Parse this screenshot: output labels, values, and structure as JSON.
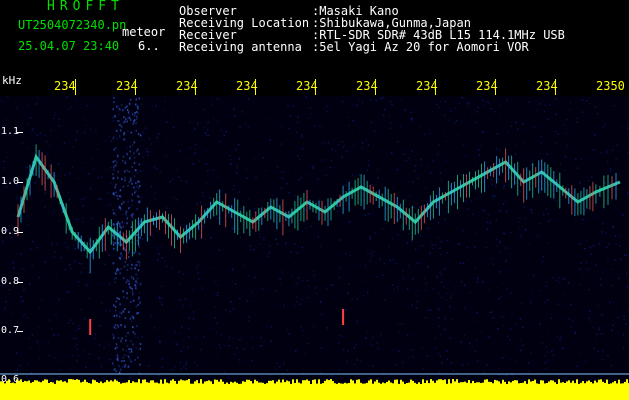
{
  "app": {
    "title": "HROFFT",
    "filename": "UT2504072340.pn",
    "event_label": "meteor",
    "timestamp": "25.04.07 23:40",
    "scale_code": "6.."
  },
  "info": [
    {
      "label": "Observer",
      "value": ":Masaki Kano"
    },
    {
      "label": "Receiving Location",
      "value": ":Shibukawa,Gunma,Japan"
    },
    {
      "label": "Receiver",
      "value": ":RTL-SDR SDR# 43dB L15 114.1MHz USB"
    },
    {
      "label": "Receiving antenna",
      "value": ":5el Yagi Az 20 for Aomori VOR"
    }
  ],
  "time_axis": {
    "labels": [
      "234",
      "234",
      "234",
      "234",
      "234",
      "234",
      "234",
      "234",
      "234",
      "2350"
    ]
  },
  "freq_axis": {
    "unit": "kHz",
    "labels": [
      "1.1",
      "1.0",
      "0.9",
      "0.8",
      "0.7",
      "0.6"
    ]
  },
  "colors": {
    "text": "#ffffff",
    "title": "#00e000",
    "axis": "#ffff00",
    "background": "#000010",
    "noise": "#0a1a70",
    "signal": "#40e0c0",
    "baseline": "#80c8ff"
  },
  "chart_data": {
    "type": "heatmap",
    "x_unit": "minute (UT)",
    "x_range": [
      "23:40",
      "23:50"
    ],
    "y_unit": "kHz",
    "ylim": [
      0.6,
      1.15
    ],
    "trace": {
      "x": [
        0,
        0.3,
        0.6,
        0.9,
        1.2,
        1.5,
        1.8,
        2.1,
        2.4,
        2.7,
        3.0,
        3.3,
        3.6,
        3.9,
        4.2,
        4.5,
        4.8,
        5.1,
        5.4,
        5.7,
        6.0,
        6.3,
        6.6,
        6.9,
        7.2,
        7.5,
        7.8,
        8.1,
        8.4,
        8.7,
        9.0,
        9.3,
        9.6,
        10.0
      ],
      "y": [
        0.93,
        1.05,
        1.0,
        0.9,
        0.86,
        0.91,
        0.88,
        0.92,
        0.93,
        0.89,
        0.92,
        0.96,
        0.94,
        0.92,
        0.95,
        0.93,
        0.96,
        0.94,
        0.97,
        0.99,
        0.97,
        0.95,
        0.92,
        0.96,
        0.98,
        1.0,
        1.02,
        1.04,
        1.0,
        1.02,
        0.99,
        0.96,
        0.98,
        1.0
      ]
    },
    "points": [
      {
        "x": 5.4,
        "y": 0.73
      },
      {
        "x": 1.2,
        "y": 0.71
      }
    ]
  }
}
